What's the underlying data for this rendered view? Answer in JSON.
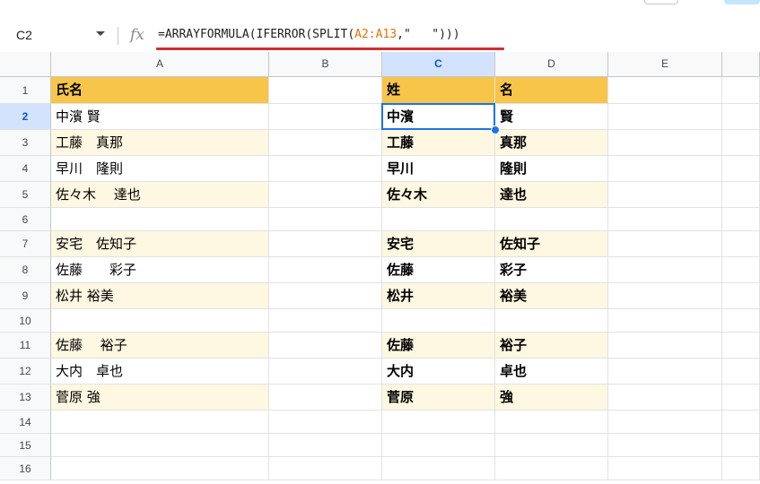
{
  "name_box": {
    "ref": "C2"
  },
  "formula_bar": {
    "fx_label": "fx",
    "prefix": "=ARRAYFORMULA(IFERROR(SPLIT(",
    "range": "A2:A13",
    "suffix": ",\"   \")))"
  },
  "columns": [
    "A",
    "B",
    "C",
    "D",
    "E"
  ],
  "selected_column": "C",
  "selected_row": 2,
  "rows": [
    {
      "num": "1",
      "a": "氏名",
      "c": "姓",
      "d": "名",
      "style": "header"
    },
    {
      "num": "2",
      "a": "中濱 賢",
      "c": "中濱",
      "d": "賢",
      "style": "plain"
    },
    {
      "num": "3",
      "a": "工藤　真那",
      "c": "工藤",
      "d": "真那",
      "style": "band"
    },
    {
      "num": "4",
      "a": "早川　隆則",
      "c": "早川",
      "d": "隆則",
      "style": "plain"
    },
    {
      "num": "5",
      "a": "佐々木　 達也",
      "c": "佐々木",
      "d": "達也",
      "style": "band"
    },
    {
      "num": "6",
      "a": "",
      "c": "",
      "d": "",
      "style": "plain"
    },
    {
      "num": "7",
      "a": "安宅　佐知子",
      "c": "安宅",
      "d": "佐知子",
      "style": "band"
    },
    {
      "num": "8",
      "a": "佐藤　　彩子",
      "c": "佐藤",
      "d": "彩子",
      "style": "plain"
    },
    {
      "num": "9",
      "a": "松井 裕美",
      "c": "松井",
      "d": "裕美",
      "style": "band"
    },
    {
      "num": "10",
      "a": "",
      "c": "",
      "d": "",
      "style": "plain"
    },
    {
      "num": "11",
      "a": "佐藤　 裕子",
      "c": "佐藤",
      "d": "裕子",
      "style": "band"
    },
    {
      "num": "12",
      "a": "大内　卓也",
      "c": "大内",
      "d": "卓也",
      "style": "plain"
    },
    {
      "num": "13",
      "a": "菅原 強",
      "c": "菅原",
      "d": "強",
      "style": "band"
    },
    {
      "num": "14",
      "a": "",
      "c": "",
      "d": "",
      "style": "empty"
    },
    {
      "num": "15",
      "a": "",
      "c": "",
      "d": "",
      "style": "empty"
    },
    {
      "num": "16",
      "a": "",
      "c": "",
      "d": "",
      "style": "empty"
    }
  ],
  "colors": {
    "header_fill": "#f6c54a",
    "band_fill": "#fef7e1",
    "selection_blue": "#1a73e8",
    "formula_range": "#e37400",
    "underline_red": "#d32f2f"
  }
}
